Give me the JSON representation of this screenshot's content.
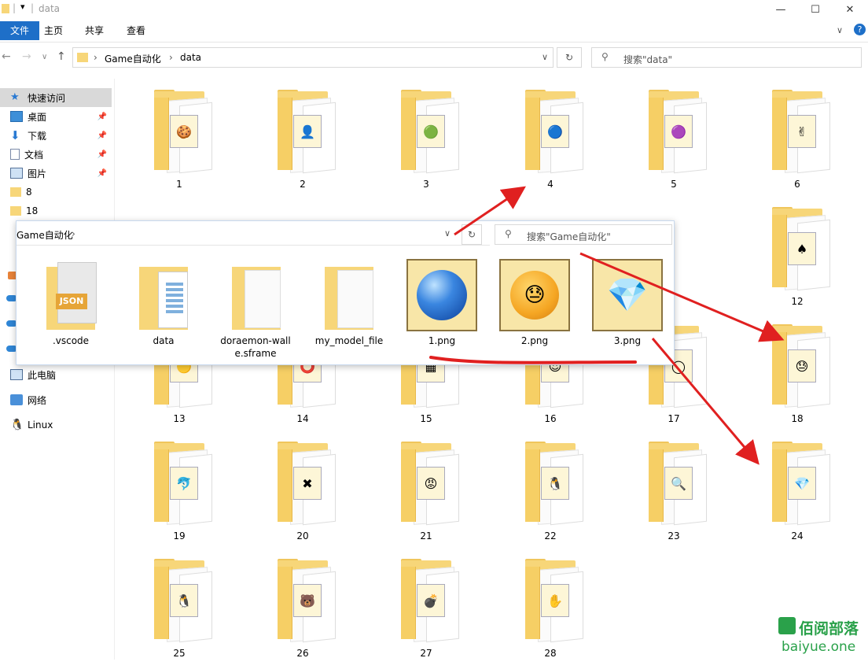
{
  "window": {
    "title": "data"
  },
  "ribbon": {
    "tabs": [
      "文件",
      "主页",
      "共享",
      "查看"
    ]
  },
  "address": {
    "crumbs": [
      "Game自动化",
      "data"
    ]
  },
  "search": {
    "placeholder": "搜索\"data\""
  },
  "sidebar": {
    "items": [
      {
        "label": "快速访问",
        "icon": "star-icon",
        "pinned": false
      },
      {
        "label": "桌面",
        "icon": "desktop-icon",
        "pinned": true
      },
      {
        "label": "下载",
        "icon": "download-icon",
        "pinned": true
      },
      {
        "label": "文档",
        "icon": "document-icon",
        "pinned": true
      },
      {
        "label": "图片",
        "icon": "pictures-icon",
        "pinned": true
      },
      {
        "label": "8",
        "icon": "folder-icon",
        "pinned": false
      },
      {
        "label": "18",
        "icon": "folder-icon",
        "pinned": false
      }
    ],
    "lower": [
      {
        "label": "此电脑",
        "icon": "computer-icon"
      },
      {
        "label": "网络",
        "icon": "network-icon"
      },
      {
        "label": "Linux",
        "icon": "linux-icon"
      }
    ]
  },
  "folders": [
    "1",
    "2",
    "3",
    "4",
    "5",
    "6",
    "12",
    "13",
    "14",
    "15",
    "16",
    "17",
    "18",
    "19",
    "20",
    "21",
    "22",
    "23",
    "24",
    "25",
    "26",
    "27",
    "28"
  ],
  "overlay": {
    "crumb": "Game自动化",
    "search_placeholder": "搜索\"Game自动化\"",
    "items": [
      ".vscode",
      "data",
      "doraemon-wall e.sframe",
      "my_model_file",
      "1.png",
      "2.png",
      "3.png"
    ]
  },
  "watermark": {
    "brand": "佰阅部落",
    "url": "baiyue.one"
  },
  "colors": {
    "accent": "#1e6fc8",
    "annotation": "#e02020",
    "folder": "#f7d679"
  }
}
